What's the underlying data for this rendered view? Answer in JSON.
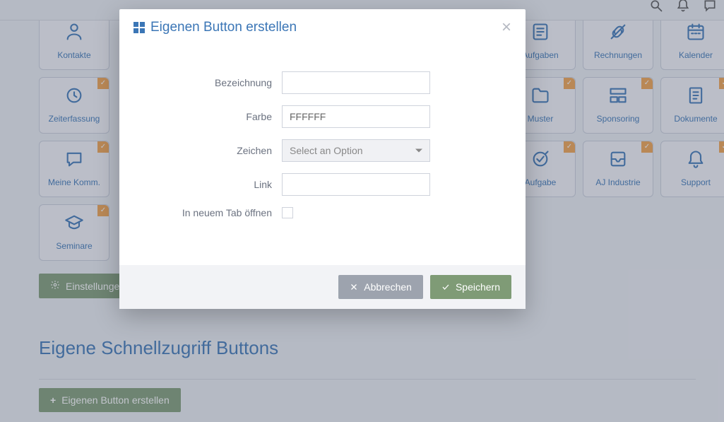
{
  "tiles": [
    {
      "key": "kontakte",
      "label": "Kontakte",
      "icon": "users",
      "check": false
    },
    {
      "key": "aufgaben",
      "label": "Aufgaben",
      "icon": "tasks",
      "check": false
    },
    {
      "key": "rechnungen",
      "label": "Rechnungen",
      "icon": "unlink",
      "check": false
    },
    {
      "key": "kalender",
      "label": "Kalender",
      "icon": "calendar",
      "check": false
    },
    {
      "key": "zeiterfassung",
      "label": "Zeiterfassung",
      "icon": "clock",
      "check": true
    },
    {
      "key": "muster",
      "label": "Muster",
      "icon": "folder",
      "check": true
    },
    {
      "key": "sponsoring",
      "label": "Sponsoring",
      "icon": "layout",
      "check": true
    },
    {
      "key": "dokumente",
      "label": "Dokumente",
      "icon": "doc",
      "check": true
    },
    {
      "key": "komm",
      "label": "Meine Komm.",
      "icon": "chat",
      "check": true
    },
    {
      "key": "aufgabe",
      "label": "Aufgabe",
      "icon": "taskcheck",
      "check": true
    },
    {
      "key": "aj",
      "label": "AJ Industrie",
      "icon": "inbox",
      "check": true
    },
    {
      "key": "support",
      "label": "Support",
      "icon": "bell",
      "check": true
    },
    {
      "key": "seminare",
      "label": "Seminare",
      "icon": "grad",
      "check": true
    }
  ],
  "settings_button": "Einstellungen",
  "section_title": "Eigene Schnellzugriff Buttons",
  "create_button": "Eigenen Button erstellen",
  "modal": {
    "title": "Eigenen Button erstellen",
    "fields": {
      "label": {
        "label": "Bezeichnung",
        "value": ""
      },
      "color": {
        "label": "Farbe",
        "value": "FFFFFF"
      },
      "icon": {
        "label": "Zeichen",
        "placeholder": "Select an Option"
      },
      "link": {
        "label": "Link",
        "value": ""
      },
      "newtab": {
        "label": "In neuem Tab öffnen",
        "checked": false
      }
    },
    "cancel": "Abbrechen",
    "save": "Speichern"
  }
}
